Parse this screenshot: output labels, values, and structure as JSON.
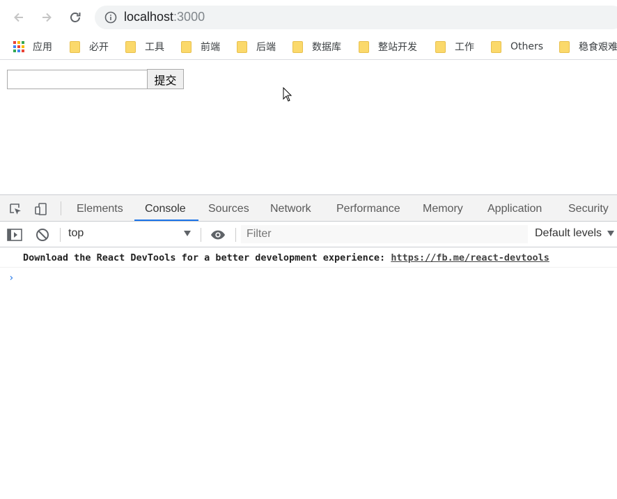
{
  "browser": {
    "url_host": "localhost",
    "url_port": ":3000"
  },
  "bookmarks": [
    {
      "label": "应用",
      "icon": "apps-icon"
    },
    {
      "label": "必开",
      "icon": "folder-icon"
    },
    {
      "label": "工具",
      "icon": "folder-icon"
    },
    {
      "label": "前端",
      "icon": "folder-icon"
    },
    {
      "label": "后端",
      "icon": "folder-icon"
    },
    {
      "label": "数据库",
      "icon": "folder-icon"
    },
    {
      "label": "整站开发",
      "icon": "folder-icon"
    },
    {
      "label": "工作",
      "icon": "folder-icon"
    },
    {
      "label": "Others",
      "icon": "folder-icon"
    },
    {
      "label": "稳食艰难",
      "icon": "folder-icon"
    }
  ],
  "page": {
    "input_value": "",
    "submit_label": "提交"
  },
  "devtools": {
    "tabs": [
      "Elements",
      "Console",
      "Sources",
      "Network",
      "Performance",
      "Memory",
      "Application",
      "Security"
    ],
    "active_tab": "Console",
    "context": "top",
    "filter_placeholder": "Filter",
    "levels": "Default levels",
    "message_text": "Download the React DevTools for a better development experience: ",
    "message_link": "https://fb.me/react-devtools",
    "prompt_symbol": "›"
  },
  "colors": {
    "accent": "#1a73e8",
    "folder": "#fbd96b"
  }
}
